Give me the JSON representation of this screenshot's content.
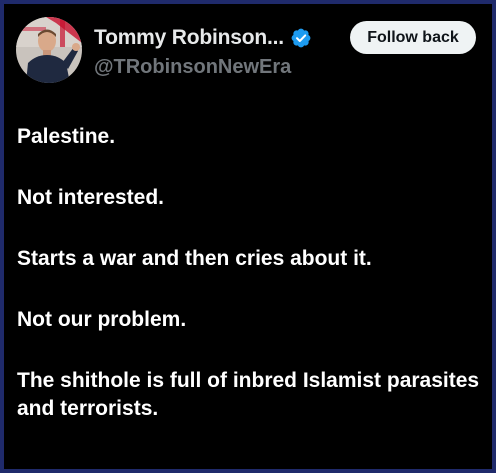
{
  "header": {
    "display_name": "Tommy Robinson...",
    "handle": "@TRobinsonNewEra",
    "follow_label": "Follow back",
    "verified_icon": "verified-badge-icon",
    "avatar_icon": "profile-photo"
  },
  "tweet": {
    "lines": [
      "Palestine.",
      "Not interested.",
      "Starts a war and then cries about it.",
      "Not our problem.",
      "The shithole is full of inbred Islamist parasites and terrorists."
    ]
  },
  "colors": {
    "background": "#000000",
    "frame_border": "#1f2a6b",
    "text_primary": "#ffffff",
    "text_secondary": "#71767b",
    "verified": "#1d9bf0",
    "button_bg": "#eff3f4",
    "button_text": "#0f1419"
  }
}
